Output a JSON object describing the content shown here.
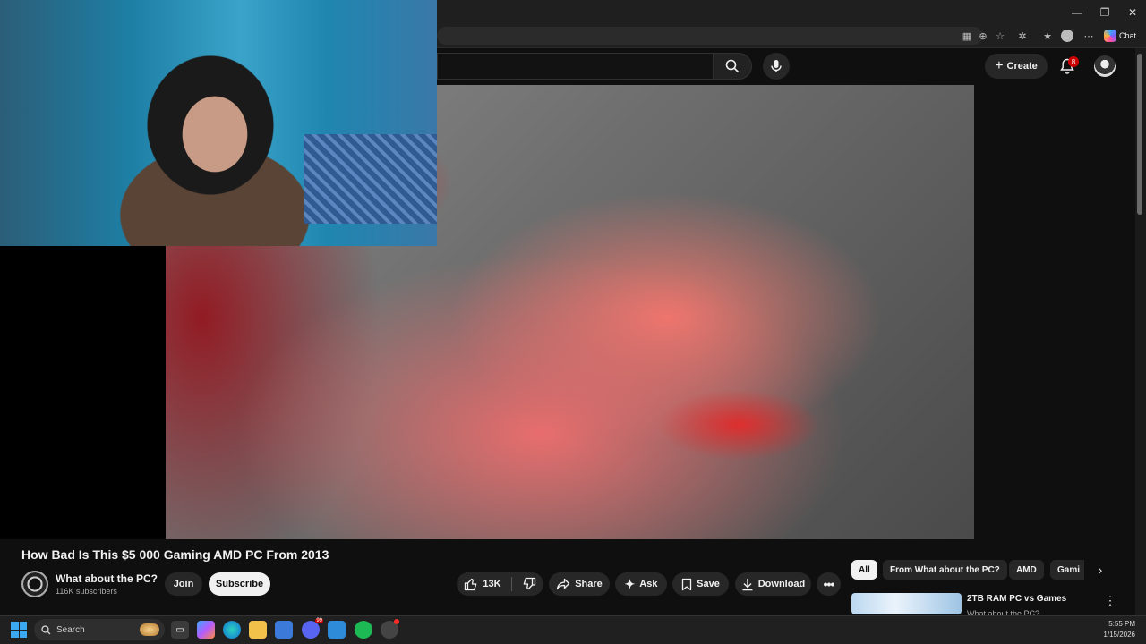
{
  "browser": {
    "chat_label": "Chat",
    "window_buttons": [
      "—",
      "❐",
      "✕"
    ]
  },
  "masthead": {
    "create_label": "Create",
    "notification_count": "8"
  },
  "video": {
    "title": "How Bad Is This $5 000 Gaming AMD PC From 2013",
    "channel_name": "What about the PC?",
    "subscribers": "116K subscribers",
    "join_label": "Join",
    "subscribe_label": "Subscribe",
    "like_count": "13K",
    "share_label": "Share",
    "ask_label": "Ask",
    "save_label": "Save",
    "download_label": "Download"
  },
  "recommendations": {
    "chips": [
      "All",
      "From What about the PC?",
      "AMD",
      "Gami"
    ],
    "items": [
      {
        "title": "2TB RAM PC vs Games",
        "channel": "What about the PC?"
      }
    ]
  },
  "taskbar": {
    "search_label": "Search",
    "discord_badge": "99",
    "time": "5:55 PM",
    "date": "1/15/2026"
  },
  "colors": {
    "accent_red": "#cc0000",
    "background": "#0f0f0f",
    "chip_bg": "#272727"
  }
}
